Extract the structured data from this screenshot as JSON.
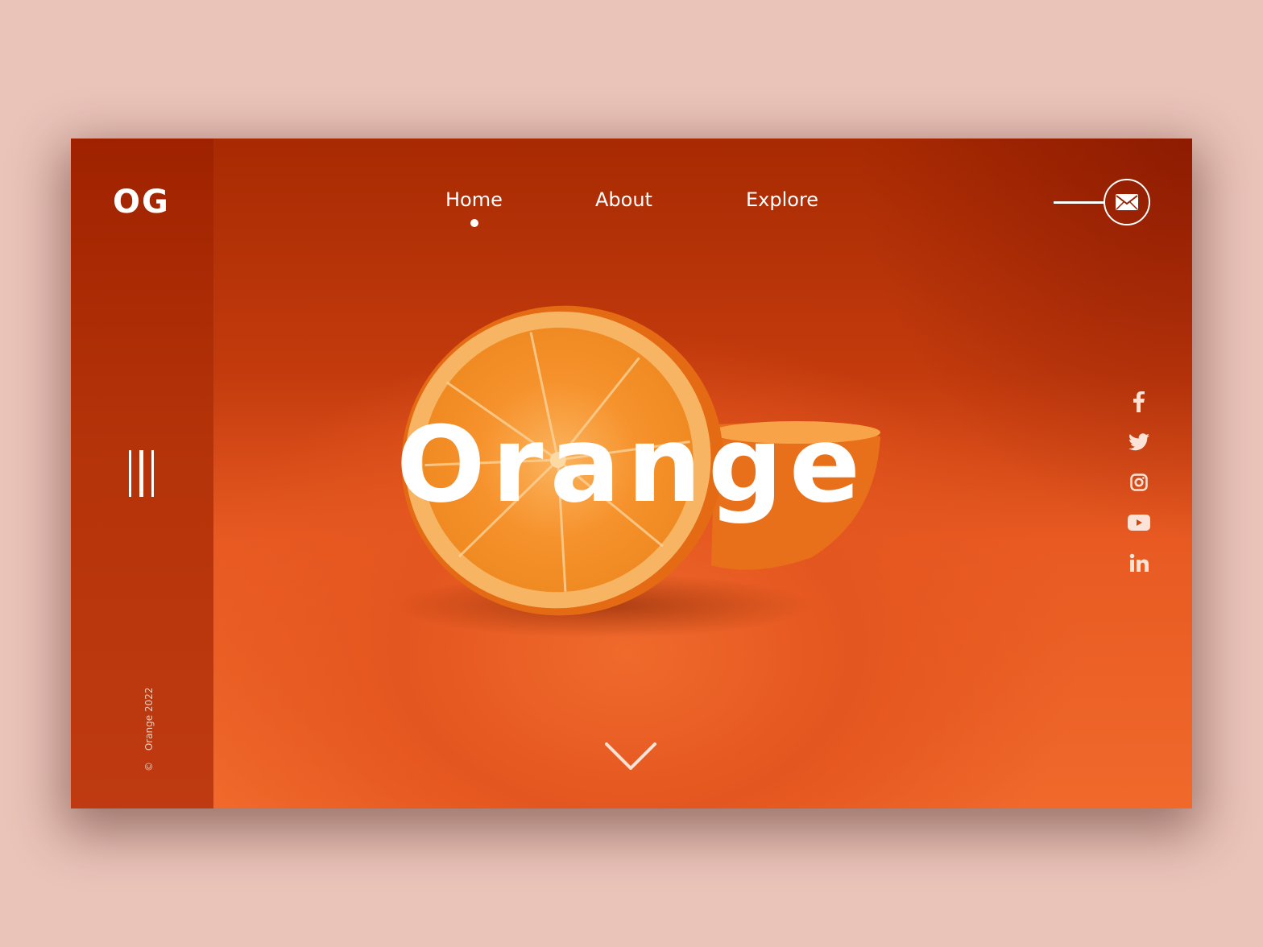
{
  "brand": {
    "logo": "OG"
  },
  "nav": {
    "items": [
      {
        "label": "Home",
        "active": true
      },
      {
        "label": "About",
        "active": false
      },
      {
        "label": "Explore",
        "active": false
      }
    ]
  },
  "contact": {
    "icon": "mail-icon"
  },
  "hero": {
    "title": "Orange"
  },
  "sidebar": {
    "menu_icon": "vertical-bars-menu-icon",
    "copyright_symbol": "©",
    "copyright_text": "Orange 2022"
  },
  "social": [
    {
      "name": "facebook",
      "icon": "facebook-icon"
    },
    {
      "name": "twitter",
      "icon": "twitter-icon"
    },
    {
      "name": "instagram",
      "icon": "instagram-icon"
    },
    {
      "name": "youtube",
      "icon": "youtube-icon"
    },
    {
      "name": "linkedin",
      "icon": "linkedin-icon"
    }
  ],
  "scroll": {
    "icon": "chevron-down-icon"
  },
  "colors": {
    "page_background": "#eac3b9",
    "sidebar": "#b53309",
    "hero_dark": "#a82a02",
    "hero_light": "#f0692b",
    "text": "#ffffff"
  }
}
